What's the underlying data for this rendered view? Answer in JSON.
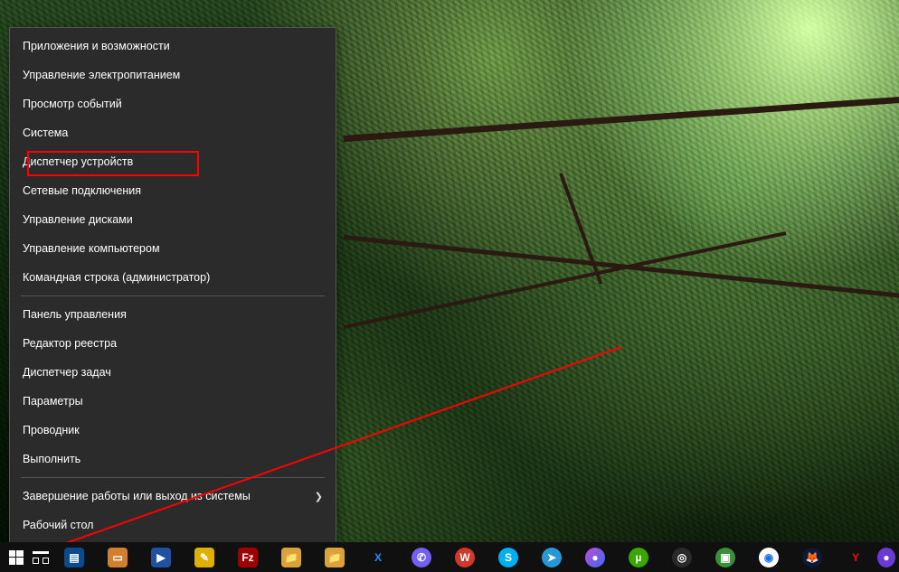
{
  "menu": {
    "group1": [
      {
        "label": "Приложения и возможности"
      },
      {
        "label": "Управление электропитанием"
      },
      {
        "label": "Просмотр событий"
      },
      {
        "label": "Система"
      },
      {
        "label": "Диспетчер устройств"
      },
      {
        "label": "Сетевые подключения"
      },
      {
        "label": "Управление дисками"
      },
      {
        "label": "Управление компьютером"
      },
      {
        "label": "Командная строка (администратор)"
      }
    ],
    "group2": [
      {
        "label": "Панель управления"
      },
      {
        "label": "Редактор реестра"
      },
      {
        "label": "Диспетчер задач"
      },
      {
        "label": "Параметры"
      },
      {
        "label": "Проводник"
      },
      {
        "label": "Выполнить"
      }
    ],
    "group3": [
      {
        "label": "Завершение работы или выход из системы",
        "has_submenu": true
      },
      {
        "label": "Рабочий стол"
      }
    ]
  },
  "highlight": {
    "item_label": "Диспетчер устройств",
    "color": "#ff0000"
  },
  "taskbar": {
    "start": "start-button",
    "task_view": "task-view-button",
    "apps": [
      {
        "name": "app-blue-1",
        "bg": "#0a4a8d",
        "glyph": "▤"
      },
      {
        "name": "app-orange-doc",
        "bg": "#d08030",
        "glyph": "▭"
      },
      {
        "name": "app-movie",
        "bg": "#2050a0",
        "glyph": "▶"
      },
      {
        "name": "app-notes",
        "bg": "#e0b000",
        "glyph": "✎"
      },
      {
        "name": "filezilla",
        "bg": "#a00000",
        "glyph": "Fz"
      },
      {
        "name": "folder-1",
        "bg": "#d9a23a",
        "glyph": "📁"
      },
      {
        "name": "folder-2",
        "bg": "#d9a23a",
        "glyph": "📁"
      },
      {
        "name": "xsplit",
        "bg": "#101010",
        "glyph": "X",
        "accent": "#1e90ff"
      },
      {
        "name": "viber",
        "bg": "#7360f2",
        "glyph": "✆",
        "round": true
      },
      {
        "name": "wps-office",
        "bg": "#d0382b",
        "glyph": "W",
        "round": true
      },
      {
        "name": "skype",
        "bg": "#00aff0",
        "glyph": "S",
        "round": true
      },
      {
        "name": "telegram",
        "bg": "#2798d4",
        "glyph": "➤",
        "round": true
      },
      {
        "name": "app-gradient",
        "bg": "linear-gradient(135deg,#c04bd8,#3a6bf0)",
        "glyph": "●",
        "round": true
      },
      {
        "name": "utorrent",
        "bg": "#3aa600",
        "glyph": "µ",
        "round": true
      },
      {
        "name": "obs-studio",
        "bg": "#2a2a2a",
        "glyph": "◎",
        "round": true
      },
      {
        "name": "camtasia",
        "bg": "#3a8f3a",
        "glyph": "▣",
        "round": true
      },
      {
        "name": "chrome",
        "bg": "#ffffff",
        "glyph": "◉",
        "round": true,
        "fg": "#1a73e8"
      },
      {
        "name": "firefox",
        "bg": "#0b1a3a",
        "glyph": "🦊",
        "round": true
      },
      {
        "name": "yandex-browser",
        "bg": "#101010",
        "glyph": "Y",
        "round": true,
        "fg": "#ff0000"
      },
      {
        "name": "app-purple-edge",
        "bg": "#6a3ad8",
        "glyph": "●",
        "round": true,
        "cut": true
      }
    ]
  }
}
